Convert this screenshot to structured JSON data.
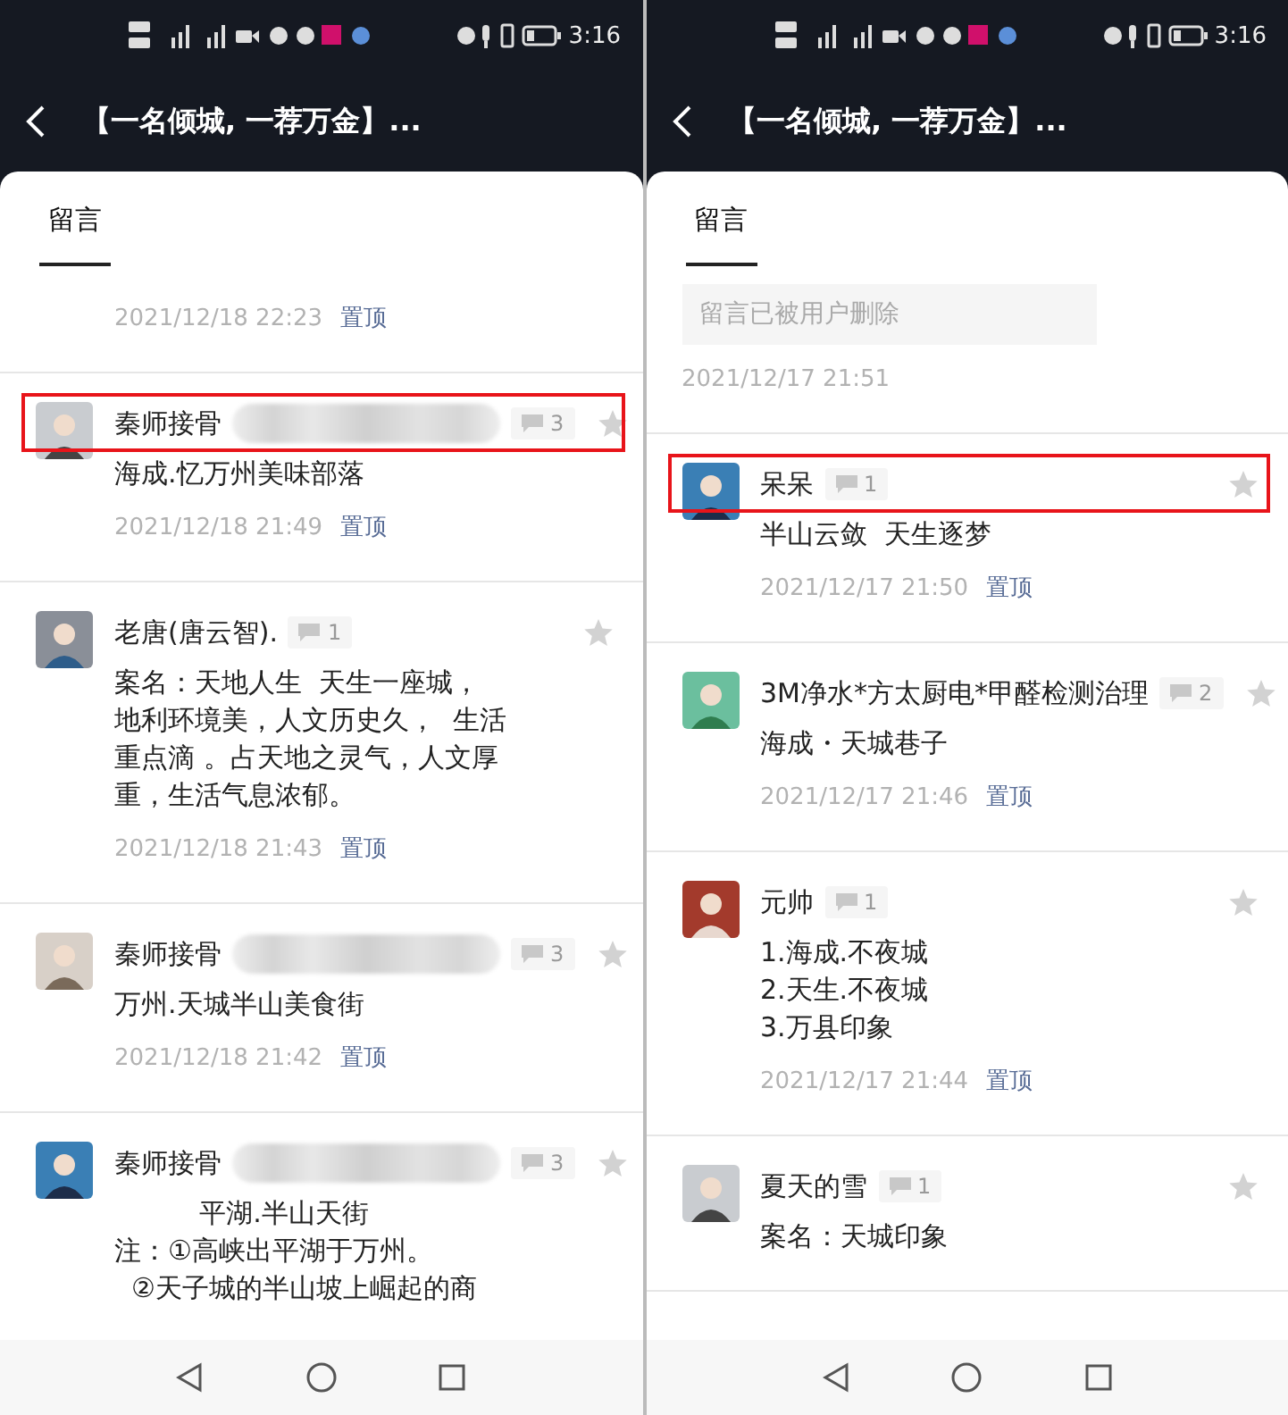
{
  "panels": [
    {
      "status_bar": {
        "time": "3:16"
      },
      "title": "【一名倾城, 一荐万金】...",
      "tabs": [
        {
          "label": "留言",
          "selected": true
        }
      ],
      "comments": [
        {
          "kind": "comment",
          "time": "2021/12/18 22:23",
          "pin": "置顶"
        },
        {
          "kind": "comment",
          "name": "秦师接骨",
          "redacted": true,
          "replies": "3",
          "content": [
            "海成.忆万州美味部落"
          ],
          "time": "2021/12/18 21:49",
          "pin": "置顶",
          "highlighted": true
        },
        {
          "kind": "comment",
          "name": "老唐(唐云智).",
          "redacted": false,
          "replies": "1",
          "content": [
            "案名：天地人生  天生一座城，",
            "地利环境美，人文历史久，  生活",
            "重点滴 。占天地之灵气，人文厚",
            "重，生活气息浓郁。"
          ],
          "time": "2021/12/18 21:43",
          "pin": "置顶",
          "highlighted": false
        },
        {
          "kind": "comment",
          "name": "秦师接骨",
          "redacted": true,
          "replies": "3",
          "content": [
            "万州.天城半山美食街"
          ],
          "time": "2021/12/18 21:42",
          "pin": "置顶",
          "highlighted": false
        },
        {
          "kind": "comment",
          "name": "秦师接骨",
          "redacted": true,
          "replies": "3",
          "content": [
            "          平湖.半山天街",
            "注：①高峡出平湖于万州。",
            "  ②天子城的半山坡上崛起的商"
          ],
          "highlighted": false
        }
      ]
    },
    {
      "status_bar": {
        "time": "3:16"
      },
      "title": "【一名倾城, 一荐万金】...",
      "tabs": [
        {
          "label": "留言",
          "selected": true
        }
      ],
      "comments": [
        {
          "kind": "deleted",
          "notice": "留言已被用户删除",
          "time": "2021/12/17 21:51"
        },
        {
          "kind": "comment",
          "name": "呆呆",
          "redacted": false,
          "replies": "1",
          "content": [
            "半山云敛  天生逐梦"
          ],
          "time": "2021/12/17 21:50",
          "pin": "置顶",
          "highlighted": true
        },
        {
          "kind": "comment",
          "name": "3M净水*方太厨电*甲醛检测治理",
          "redacted": false,
          "replies": "2",
          "content": [
            "海成・天城巷子"
          ],
          "time": "2021/12/17 21:46",
          "pin": "置顶",
          "highlighted": false
        },
        {
          "kind": "comment",
          "name": "元帅",
          "redacted": false,
          "replies": "1",
          "content": [
            "1.海成.不夜城",
            "2.天生.不夜城",
            "3.万县印象"
          ],
          "time": "2021/12/17 21:44",
          "pin": "置顶",
          "highlighted": false
        },
        {
          "kind": "comment",
          "name": "夏天的雪",
          "redacted": false,
          "replies": "1",
          "content": [
            "案名：天城印象"
          ],
          "highlighted": false
        }
      ]
    }
  ]
}
